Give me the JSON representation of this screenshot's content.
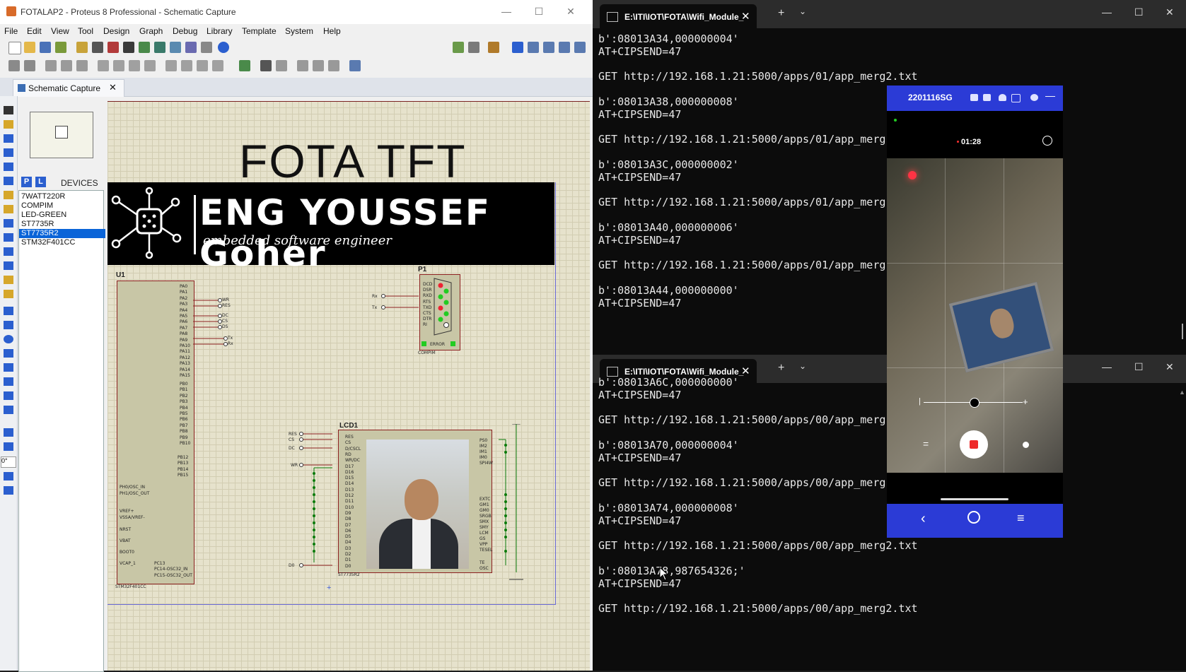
{
  "proteus": {
    "title": "FOTALAP2 - Proteus 8 Professional - Schematic Capture",
    "menu": [
      "File",
      "Edit",
      "View",
      "Tool",
      "Design",
      "Graph",
      "Debug",
      "Library",
      "Template",
      "System",
      "Help"
    ],
    "tab_label": "Schematic Capture",
    "devices": {
      "p_button": "P",
      "l_button": "L",
      "header": "DEVICES",
      "items": [
        "7WATT220R",
        "COMPIM",
        "LED-GREEN",
        "ST7735R",
        "ST7735R2",
        "STM32F401CC"
      ],
      "selected_index": 4
    },
    "rotation_value": "0°",
    "schematic": {
      "title": "FOTA TFT",
      "banner_name": "ENG YOUSSEF Goher",
      "banner_sub": "embedded software engineer",
      "u1_label": "U1",
      "u1_part": "STM32F401CC",
      "p1_label": "P1",
      "p1_part": "COMPIM",
      "p1_error": "ERROR",
      "lcd_label": "LCD1",
      "lcd_part": "ST7735R2",
      "u1_pins_a": [
        "PA0",
        "PA1",
        "PA2",
        "PA3",
        "PA4",
        "PA5",
        "PA6",
        "PA7",
        "PA8",
        "PA9",
        "PA10",
        "PA11",
        "PA12",
        "PA13",
        "PA14",
        "PA15"
      ],
      "u1_pins_b": [
        "PB0",
        "PB1",
        "PB2",
        "PB3",
        "PB4",
        "PB5",
        "PB6",
        "PB7",
        "PB8",
        "PB9",
        "PB10"
      ],
      "u1_pins_c": [
        "PB12",
        "PB13",
        "PB14",
        "PB15"
      ],
      "u1_power": [
        "PH0/OSC_IN",
        "PH1/OSC_OUT",
        "VREF+",
        "VSSA/VREF-",
        "NRST",
        "VBAT",
        "BOOT0",
        "VCAP_1"
      ],
      "u1_pc": [
        "PC13",
        "PC14-OSC32_IN",
        "PC15-OSC32_OUT"
      ],
      "net_right": [
        "WR",
        "RES",
        "DC",
        "CS",
        "DS",
        "Tx",
        "Rx"
      ],
      "p1_pins": [
        "DCD",
        "DSR",
        "RXD",
        "RTS",
        "TXD",
        "CTS",
        "DTR",
        "RI"
      ],
      "p1_nets": [
        "Rx",
        "Tx"
      ],
      "lcd_left_nets": [
        "RES",
        "CS",
        "DC",
        "WR",
        "D0"
      ],
      "lcd_pins_left": [
        "RES",
        "CS",
        "D/CSCL",
        "RD",
        "WR/DC",
        "D17",
        "D16",
        "D15",
        "D14",
        "D13",
        "D12",
        "D11",
        "D10",
        "D9",
        "D8",
        "D7",
        "D6",
        "D5",
        "D4",
        "D3",
        "D2",
        "D1",
        "D0"
      ],
      "lcd_pins_right": [
        "PS0",
        "IM2",
        "IM1",
        "IM0",
        "SPI4W",
        "EXTC",
        "GM1",
        "GM0",
        "SRGB",
        "SMX",
        "SMY",
        "LCM",
        "GS",
        "VPP",
        "TESEL",
        "TE",
        "OSC"
      ]
    }
  },
  "terminal_top": {
    "tab_title": "E:\\ITI\\IOT\\FOTA\\Wifi_Module_",
    "lines": [
      "b':08013A34,000000004'",
      "AT+CIPSEND=47",
      "",
      "GET http://192.168.1.21:5000/apps/01/app_merg2.txt",
      "",
      "b':08013A38,000000008'",
      "AT+CIPSEND=47",
      "",
      "GET http://192.168.1.21:5000/apps/01/app_merg",
      "",
      "b':08013A3C,000000002'",
      "AT+CIPSEND=47",
      "",
      "GET http://192.168.1.21:5000/apps/01/app_merg",
      "",
      "b':08013A40,000000006'",
      "AT+CIPSEND=47",
      "",
      "GET http://192.168.1.21:5000/apps/01/app_merg",
      "",
      "b':08013A44,000000000'",
      "AT+CIPSEND=47"
    ]
  },
  "terminal_bottom": {
    "tab_title": "E:\\ITI\\IOT\\FOTA\\Wifi_Module_",
    "lines": [
      "b':08013A6C,000000000'",
      "AT+CIPSEND=47",
      "",
      "GET http://192.168.1.21:5000/apps/00/app_merg",
      "",
      "b':08013A70,000000004'",
      "AT+CIPSEND=47",
      "",
      "GET http://192.168.1.21:5000/apps/00/app_merg",
      "",
      "b':08013A74,000000008'",
      "AT+CIPSEND=47",
      "",
      "GET http://192.168.1.21:5000/apps/00/app_merg2.txt",
      "",
      "b':08013A78,987654326;'",
      "AT+CIPSEND=47",
      "",
      "GET http://192.168.1.21:5000/apps/00/app_merg2.txt"
    ]
  },
  "phone": {
    "model": "2201116SG",
    "record_time": "01:28"
  },
  "colors": {
    "proteus_canvas": "#e6e2cc",
    "selection": "#0a64d8",
    "terminal_bg": "#0c0c0c",
    "phone_bar": "#2b3bd6",
    "record_red": "#ee2a2a"
  }
}
